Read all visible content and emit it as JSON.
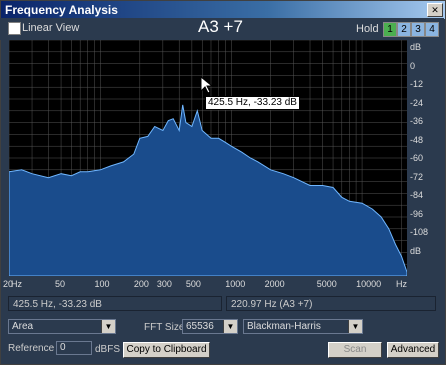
{
  "window": {
    "title": "Frequency Analysis"
  },
  "toolbar": {
    "linear_view_label": "Linear View",
    "linear_view_checked": false,
    "note": "A3 +7",
    "hold_label": "Hold",
    "hold_buttons": [
      "1",
      "2",
      "3",
      "4"
    ],
    "hold_active_color": "#4caf50"
  },
  "y_axis_labels": [
    "dB",
    "0",
    "-12",
    "-24",
    "-36",
    "-48",
    "-60",
    "-72",
    "-84",
    "-96",
    "-108",
    "dB"
  ],
  "x_axis_labels": [
    "Hz",
    "20",
    "50",
    "100",
    "200",
    "300",
    "500",
    "1000",
    "2000",
    "5000",
    "10000",
    "Hz"
  ],
  "tooltip": "425.5 Hz, -33.23 dB",
  "status": {
    "left": "425.5 Hz, -33.23 dB",
    "right": "220.97 Hz (A3 +7)"
  },
  "controls": {
    "algorithm": "Area",
    "fft_size_label": "FFT Size",
    "fft_size": "65536",
    "window_func": "Blackman-Harris",
    "reference_label": "Reference",
    "reference_value": "0",
    "dbfs_label": "dBFS",
    "copy_button": "Copy to Clipboard",
    "scan_button": "Scan",
    "advanced_button": "Advanced"
  },
  "colors": {
    "fill": "#1a4c8c",
    "line": "#6fb6ff",
    "grid": "#555555"
  },
  "chart_data": {
    "type": "area",
    "xscale": "log",
    "xlim": [
      20,
      22050
    ],
    "ylim": [
      -120,
      0
    ],
    "x": [
      20,
      25,
      30,
      40,
      50,
      60,
      70,
      80,
      100,
      120,
      150,
      180,
      200,
      230,
      260,
      300,
      330,
      360,
      400,
      425.5,
      450,
      500,
      550,
      600,
      700,
      800,
      900,
      1000,
      1200,
      1400,
      1600,
      2000,
      2500,
      3000,
      4000,
      5000,
      6000,
      7000,
      8000,
      10000,
      12000,
      14000,
      16000,
      18000,
      20000,
      22050
    ],
    "y": [
      -67,
      -66,
      -68,
      -70,
      -68,
      -69,
      -67,
      -67,
      -66,
      -64,
      -62,
      -58,
      -50,
      -49,
      -44,
      -46,
      -41,
      -40,
      -46,
      -33,
      -42,
      -44,
      -36,
      -46,
      -50,
      -50,
      -52,
      -54,
      -57,
      -60,
      -62,
      -66,
      -68,
      -70,
      -74,
      -74,
      -75,
      -80,
      -82,
      -83,
      -86,
      -90,
      -96,
      -104,
      -110,
      -118
    ]
  }
}
